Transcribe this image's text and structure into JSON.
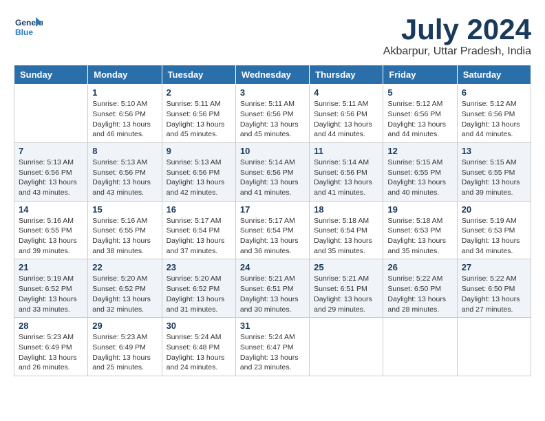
{
  "logo": {
    "line1": "General",
    "line2": "Blue"
  },
  "title": "July 2024",
  "subtitle": "Akbarpur, Uttar Pradesh, India",
  "days_of_week": [
    "Sunday",
    "Monday",
    "Tuesday",
    "Wednesday",
    "Thursday",
    "Friday",
    "Saturday"
  ],
  "weeks": [
    [
      {
        "day": "",
        "sunrise": "",
        "sunset": "",
        "daylight": ""
      },
      {
        "day": "1",
        "sunrise": "Sunrise: 5:10 AM",
        "sunset": "Sunset: 6:56 PM",
        "daylight": "Daylight: 13 hours and 46 minutes."
      },
      {
        "day": "2",
        "sunrise": "Sunrise: 5:11 AM",
        "sunset": "Sunset: 6:56 PM",
        "daylight": "Daylight: 13 hours and 45 minutes."
      },
      {
        "day": "3",
        "sunrise": "Sunrise: 5:11 AM",
        "sunset": "Sunset: 6:56 PM",
        "daylight": "Daylight: 13 hours and 45 minutes."
      },
      {
        "day": "4",
        "sunrise": "Sunrise: 5:11 AM",
        "sunset": "Sunset: 6:56 PM",
        "daylight": "Daylight: 13 hours and 44 minutes."
      },
      {
        "day": "5",
        "sunrise": "Sunrise: 5:12 AM",
        "sunset": "Sunset: 6:56 PM",
        "daylight": "Daylight: 13 hours and 44 minutes."
      },
      {
        "day": "6",
        "sunrise": "Sunrise: 5:12 AM",
        "sunset": "Sunset: 6:56 PM",
        "daylight": "Daylight: 13 hours and 44 minutes."
      }
    ],
    [
      {
        "day": "7",
        "sunrise": "Sunrise: 5:13 AM",
        "sunset": "Sunset: 6:56 PM",
        "daylight": "Daylight: 13 hours and 43 minutes."
      },
      {
        "day": "8",
        "sunrise": "Sunrise: 5:13 AM",
        "sunset": "Sunset: 6:56 PM",
        "daylight": "Daylight: 13 hours and 43 minutes."
      },
      {
        "day": "9",
        "sunrise": "Sunrise: 5:13 AM",
        "sunset": "Sunset: 6:56 PM",
        "daylight": "Daylight: 13 hours and 42 minutes."
      },
      {
        "day": "10",
        "sunrise": "Sunrise: 5:14 AM",
        "sunset": "Sunset: 6:56 PM",
        "daylight": "Daylight: 13 hours and 41 minutes."
      },
      {
        "day": "11",
        "sunrise": "Sunrise: 5:14 AM",
        "sunset": "Sunset: 6:56 PM",
        "daylight": "Daylight: 13 hours and 41 minutes."
      },
      {
        "day": "12",
        "sunrise": "Sunrise: 5:15 AM",
        "sunset": "Sunset: 6:55 PM",
        "daylight": "Daylight: 13 hours and 40 minutes."
      },
      {
        "day": "13",
        "sunrise": "Sunrise: 5:15 AM",
        "sunset": "Sunset: 6:55 PM",
        "daylight": "Daylight: 13 hours and 39 minutes."
      }
    ],
    [
      {
        "day": "14",
        "sunrise": "Sunrise: 5:16 AM",
        "sunset": "Sunset: 6:55 PM",
        "daylight": "Daylight: 13 hours and 39 minutes."
      },
      {
        "day": "15",
        "sunrise": "Sunrise: 5:16 AM",
        "sunset": "Sunset: 6:55 PM",
        "daylight": "Daylight: 13 hours and 38 minutes."
      },
      {
        "day": "16",
        "sunrise": "Sunrise: 5:17 AM",
        "sunset": "Sunset: 6:54 PM",
        "daylight": "Daylight: 13 hours and 37 minutes."
      },
      {
        "day": "17",
        "sunrise": "Sunrise: 5:17 AM",
        "sunset": "Sunset: 6:54 PM",
        "daylight": "Daylight: 13 hours and 36 minutes."
      },
      {
        "day": "18",
        "sunrise": "Sunrise: 5:18 AM",
        "sunset": "Sunset: 6:54 PM",
        "daylight": "Daylight: 13 hours and 35 minutes."
      },
      {
        "day": "19",
        "sunrise": "Sunrise: 5:18 AM",
        "sunset": "Sunset: 6:53 PM",
        "daylight": "Daylight: 13 hours and 35 minutes."
      },
      {
        "day": "20",
        "sunrise": "Sunrise: 5:19 AM",
        "sunset": "Sunset: 6:53 PM",
        "daylight": "Daylight: 13 hours and 34 minutes."
      }
    ],
    [
      {
        "day": "21",
        "sunrise": "Sunrise: 5:19 AM",
        "sunset": "Sunset: 6:52 PM",
        "daylight": "Daylight: 13 hours and 33 minutes."
      },
      {
        "day": "22",
        "sunrise": "Sunrise: 5:20 AM",
        "sunset": "Sunset: 6:52 PM",
        "daylight": "Daylight: 13 hours and 32 minutes."
      },
      {
        "day": "23",
        "sunrise": "Sunrise: 5:20 AM",
        "sunset": "Sunset: 6:52 PM",
        "daylight": "Daylight: 13 hours and 31 minutes."
      },
      {
        "day": "24",
        "sunrise": "Sunrise: 5:21 AM",
        "sunset": "Sunset: 6:51 PM",
        "daylight": "Daylight: 13 hours and 30 minutes."
      },
      {
        "day": "25",
        "sunrise": "Sunrise: 5:21 AM",
        "sunset": "Sunset: 6:51 PM",
        "daylight": "Daylight: 13 hours and 29 minutes."
      },
      {
        "day": "26",
        "sunrise": "Sunrise: 5:22 AM",
        "sunset": "Sunset: 6:50 PM",
        "daylight": "Daylight: 13 hours and 28 minutes."
      },
      {
        "day": "27",
        "sunrise": "Sunrise: 5:22 AM",
        "sunset": "Sunset: 6:50 PM",
        "daylight": "Daylight: 13 hours and 27 minutes."
      }
    ],
    [
      {
        "day": "28",
        "sunrise": "Sunrise: 5:23 AM",
        "sunset": "Sunset: 6:49 PM",
        "daylight": "Daylight: 13 hours and 26 minutes."
      },
      {
        "day": "29",
        "sunrise": "Sunrise: 5:23 AM",
        "sunset": "Sunset: 6:49 PM",
        "daylight": "Daylight: 13 hours and 25 minutes."
      },
      {
        "day": "30",
        "sunrise": "Sunrise: 5:24 AM",
        "sunset": "Sunset: 6:48 PM",
        "daylight": "Daylight: 13 hours and 24 minutes."
      },
      {
        "day": "31",
        "sunrise": "Sunrise: 5:24 AM",
        "sunset": "Sunset: 6:47 PM",
        "daylight": "Daylight: 13 hours and 23 minutes."
      },
      {
        "day": "",
        "sunrise": "",
        "sunset": "",
        "daylight": ""
      },
      {
        "day": "",
        "sunrise": "",
        "sunset": "",
        "daylight": ""
      },
      {
        "day": "",
        "sunrise": "",
        "sunset": "",
        "daylight": ""
      }
    ]
  ]
}
